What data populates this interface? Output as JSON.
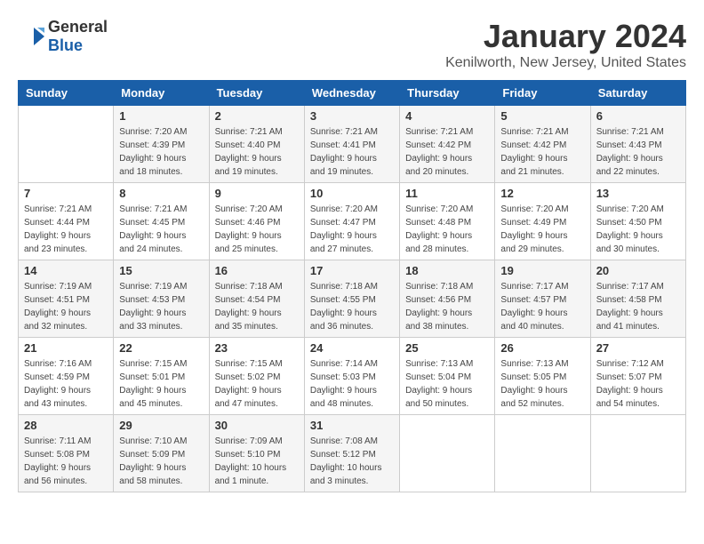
{
  "header": {
    "logo_general": "General",
    "logo_blue": "Blue",
    "month": "January 2024",
    "location": "Kenilworth, New Jersey, United States"
  },
  "weekdays": [
    "Sunday",
    "Monday",
    "Tuesday",
    "Wednesday",
    "Thursday",
    "Friday",
    "Saturday"
  ],
  "weeks": [
    [
      {
        "day": "",
        "sunrise": "",
        "sunset": "",
        "daylight": ""
      },
      {
        "day": "1",
        "sunrise": "Sunrise: 7:20 AM",
        "sunset": "Sunset: 4:39 PM",
        "daylight": "Daylight: 9 hours and 18 minutes."
      },
      {
        "day": "2",
        "sunrise": "Sunrise: 7:21 AM",
        "sunset": "Sunset: 4:40 PM",
        "daylight": "Daylight: 9 hours and 19 minutes."
      },
      {
        "day": "3",
        "sunrise": "Sunrise: 7:21 AM",
        "sunset": "Sunset: 4:41 PM",
        "daylight": "Daylight: 9 hours and 19 minutes."
      },
      {
        "day": "4",
        "sunrise": "Sunrise: 7:21 AM",
        "sunset": "Sunset: 4:42 PM",
        "daylight": "Daylight: 9 hours and 20 minutes."
      },
      {
        "day": "5",
        "sunrise": "Sunrise: 7:21 AM",
        "sunset": "Sunset: 4:42 PM",
        "daylight": "Daylight: 9 hours and 21 minutes."
      },
      {
        "day": "6",
        "sunrise": "Sunrise: 7:21 AM",
        "sunset": "Sunset: 4:43 PM",
        "daylight": "Daylight: 9 hours and 22 minutes."
      }
    ],
    [
      {
        "day": "7",
        "sunrise": "Sunrise: 7:21 AM",
        "sunset": "Sunset: 4:44 PM",
        "daylight": "Daylight: 9 hours and 23 minutes."
      },
      {
        "day": "8",
        "sunrise": "Sunrise: 7:21 AM",
        "sunset": "Sunset: 4:45 PM",
        "daylight": "Daylight: 9 hours and 24 minutes."
      },
      {
        "day": "9",
        "sunrise": "Sunrise: 7:20 AM",
        "sunset": "Sunset: 4:46 PM",
        "daylight": "Daylight: 9 hours and 25 minutes."
      },
      {
        "day": "10",
        "sunrise": "Sunrise: 7:20 AM",
        "sunset": "Sunset: 4:47 PM",
        "daylight": "Daylight: 9 hours and 27 minutes."
      },
      {
        "day": "11",
        "sunrise": "Sunrise: 7:20 AM",
        "sunset": "Sunset: 4:48 PM",
        "daylight": "Daylight: 9 hours and 28 minutes."
      },
      {
        "day": "12",
        "sunrise": "Sunrise: 7:20 AM",
        "sunset": "Sunset: 4:49 PM",
        "daylight": "Daylight: 9 hours and 29 minutes."
      },
      {
        "day": "13",
        "sunrise": "Sunrise: 7:20 AM",
        "sunset": "Sunset: 4:50 PM",
        "daylight": "Daylight: 9 hours and 30 minutes."
      }
    ],
    [
      {
        "day": "14",
        "sunrise": "Sunrise: 7:19 AM",
        "sunset": "Sunset: 4:51 PM",
        "daylight": "Daylight: 9 hours and 32 minutes."
      },
      {
        "day": "15",
        "sunrise": "Sunrise: 7:19 AM",
        "sunset": "Sunset: 4:53 PM",
        "daylight": "Daylight: 9 hours and 33 minutes."
      },
      {
        "day": "16",
        "sunrise": "Sunrise: 7:18 AM",
        "sunset": "Sunset: 4:54 PM",
        "daylight": "Daylight: 9 hours and 35 minutes."
      },
      {
        "day": "17",
        "sunrise": "Sunrise: 7:18 AM",
        "sunset": "Sunset: 4:55 PM",
        "daylight": "Daylight: 9 hours and 36 minutes."
      },
      {
        "day": "18",
        "sunrise": "Sunrise: 7:18 AM",
        "sunset": "Sunset: 4:56 PM",
        "daylight": "Daylight: 9 hours and 38 minutes."
      },
      {
        "day": "19",
        "sunrise": "Sunrise: 7:17 AM",
        "sunset": "Sunset: 4:57 PM",
        "daylight": "Daylight: 9 hours and 40 minutes."
      },
      {
        "day": "20",
        "sunrise": "Sunrise: 7:17 AM",
        "sunset": "Sunset: 4:58 PM",
        "daylight": "Daylight: 9 hours and 41 minutes."
      }
    ],
    [
      {
        "day": "21",
        "sunrise": "Sunrise: 7:16 AM",
        "sunset": "Sunset: 4:59 PM",
        "daylight": "Daylight: 9 hours and 43 minutes."
      },
      {
        "day": "22",
        "sunrise": "Sunrise: 7:15 AM",
        "sunset": "Sunset: 5:01 PM",
        "daylight": "Daylight: 9 hours and 45 minutes."
      },
      {
        "day": "23",
        "sunrise": "Sunrise: 7:15 AM",
        "sunset": "Sunset: 5:02 PM",
        "daylight": "Daylight: 9 hours and 47 minutes."
      },
      {
        "day": "24",
        "sunrise": "Sunrise: 7:14 AM",
        "sunset": "Sunset: 5:03 PM",
        "daylight": "Daylight: 9 hours and 48 minutes."
      },
      {
        "day": "25",
        "sunrise": "Sunrise: 7:13 AM",
        "sunset": "Sunset: 5:04 PM",
        "daylight": "Daylight: 9 hours and 50 minutes."
      },
      {
        "day": "26",
        "sunrise": "Sunrise: 7:13 AM",
        "sunset": "Sunset: 5:05 PM",
        "daylight": "Daylight: 9 hours and 52 minutes."
      },
      {
        "day": "27",
        "sunrise": "Sunrise: 7:12 AM",
        "sunset": "Sunset: 5:07 PM",
        "daylight": "Daylight: 9 hours and 54 minutes."
      }
    ],
    [
      {
        "day": "28",
        "sunrise": "Sunrise: 7:11 AM",
        "sunset": "Sunset: 5:08 PM",
        "daylight": "Daylight: 9 hours and 56 minutes."
      },
      {
        "day": "29",
        "sunrise": "Sunrise: 7:10 AM",
        "sunset": "Sunset: 5:09 PM",
        "daylight": "Daylight: 9 hours and 58 minutes."
      },
      {
        "day": "30",
        "sunrise": "Sunrise: 7:09 AM",
        "sunset": "Sunset: 5:10 PM",
        "daylight": "Daylight: 10 hours and 1 minute."
      },
      {
        "day": "31",
        "sunrise": "Sunrise: 7:08 AM",
        "sunset": "Sunset: 5:12 PM",
        "daylight": "Daylight: 10 hours and 3 minutes."
      },
      {
        "day": "",
        "sunrise": "",
        "sunset": "",
        "daylight": ""
      },
      {
        "day": "",
        "sunrise": "",
        "sunset": "",
        "daylight": ""
      },
      {
        "day": "",
        "sunrise": "",
        "sunset": "",
        "daylight": ""
      }
    ]
  ]
}
